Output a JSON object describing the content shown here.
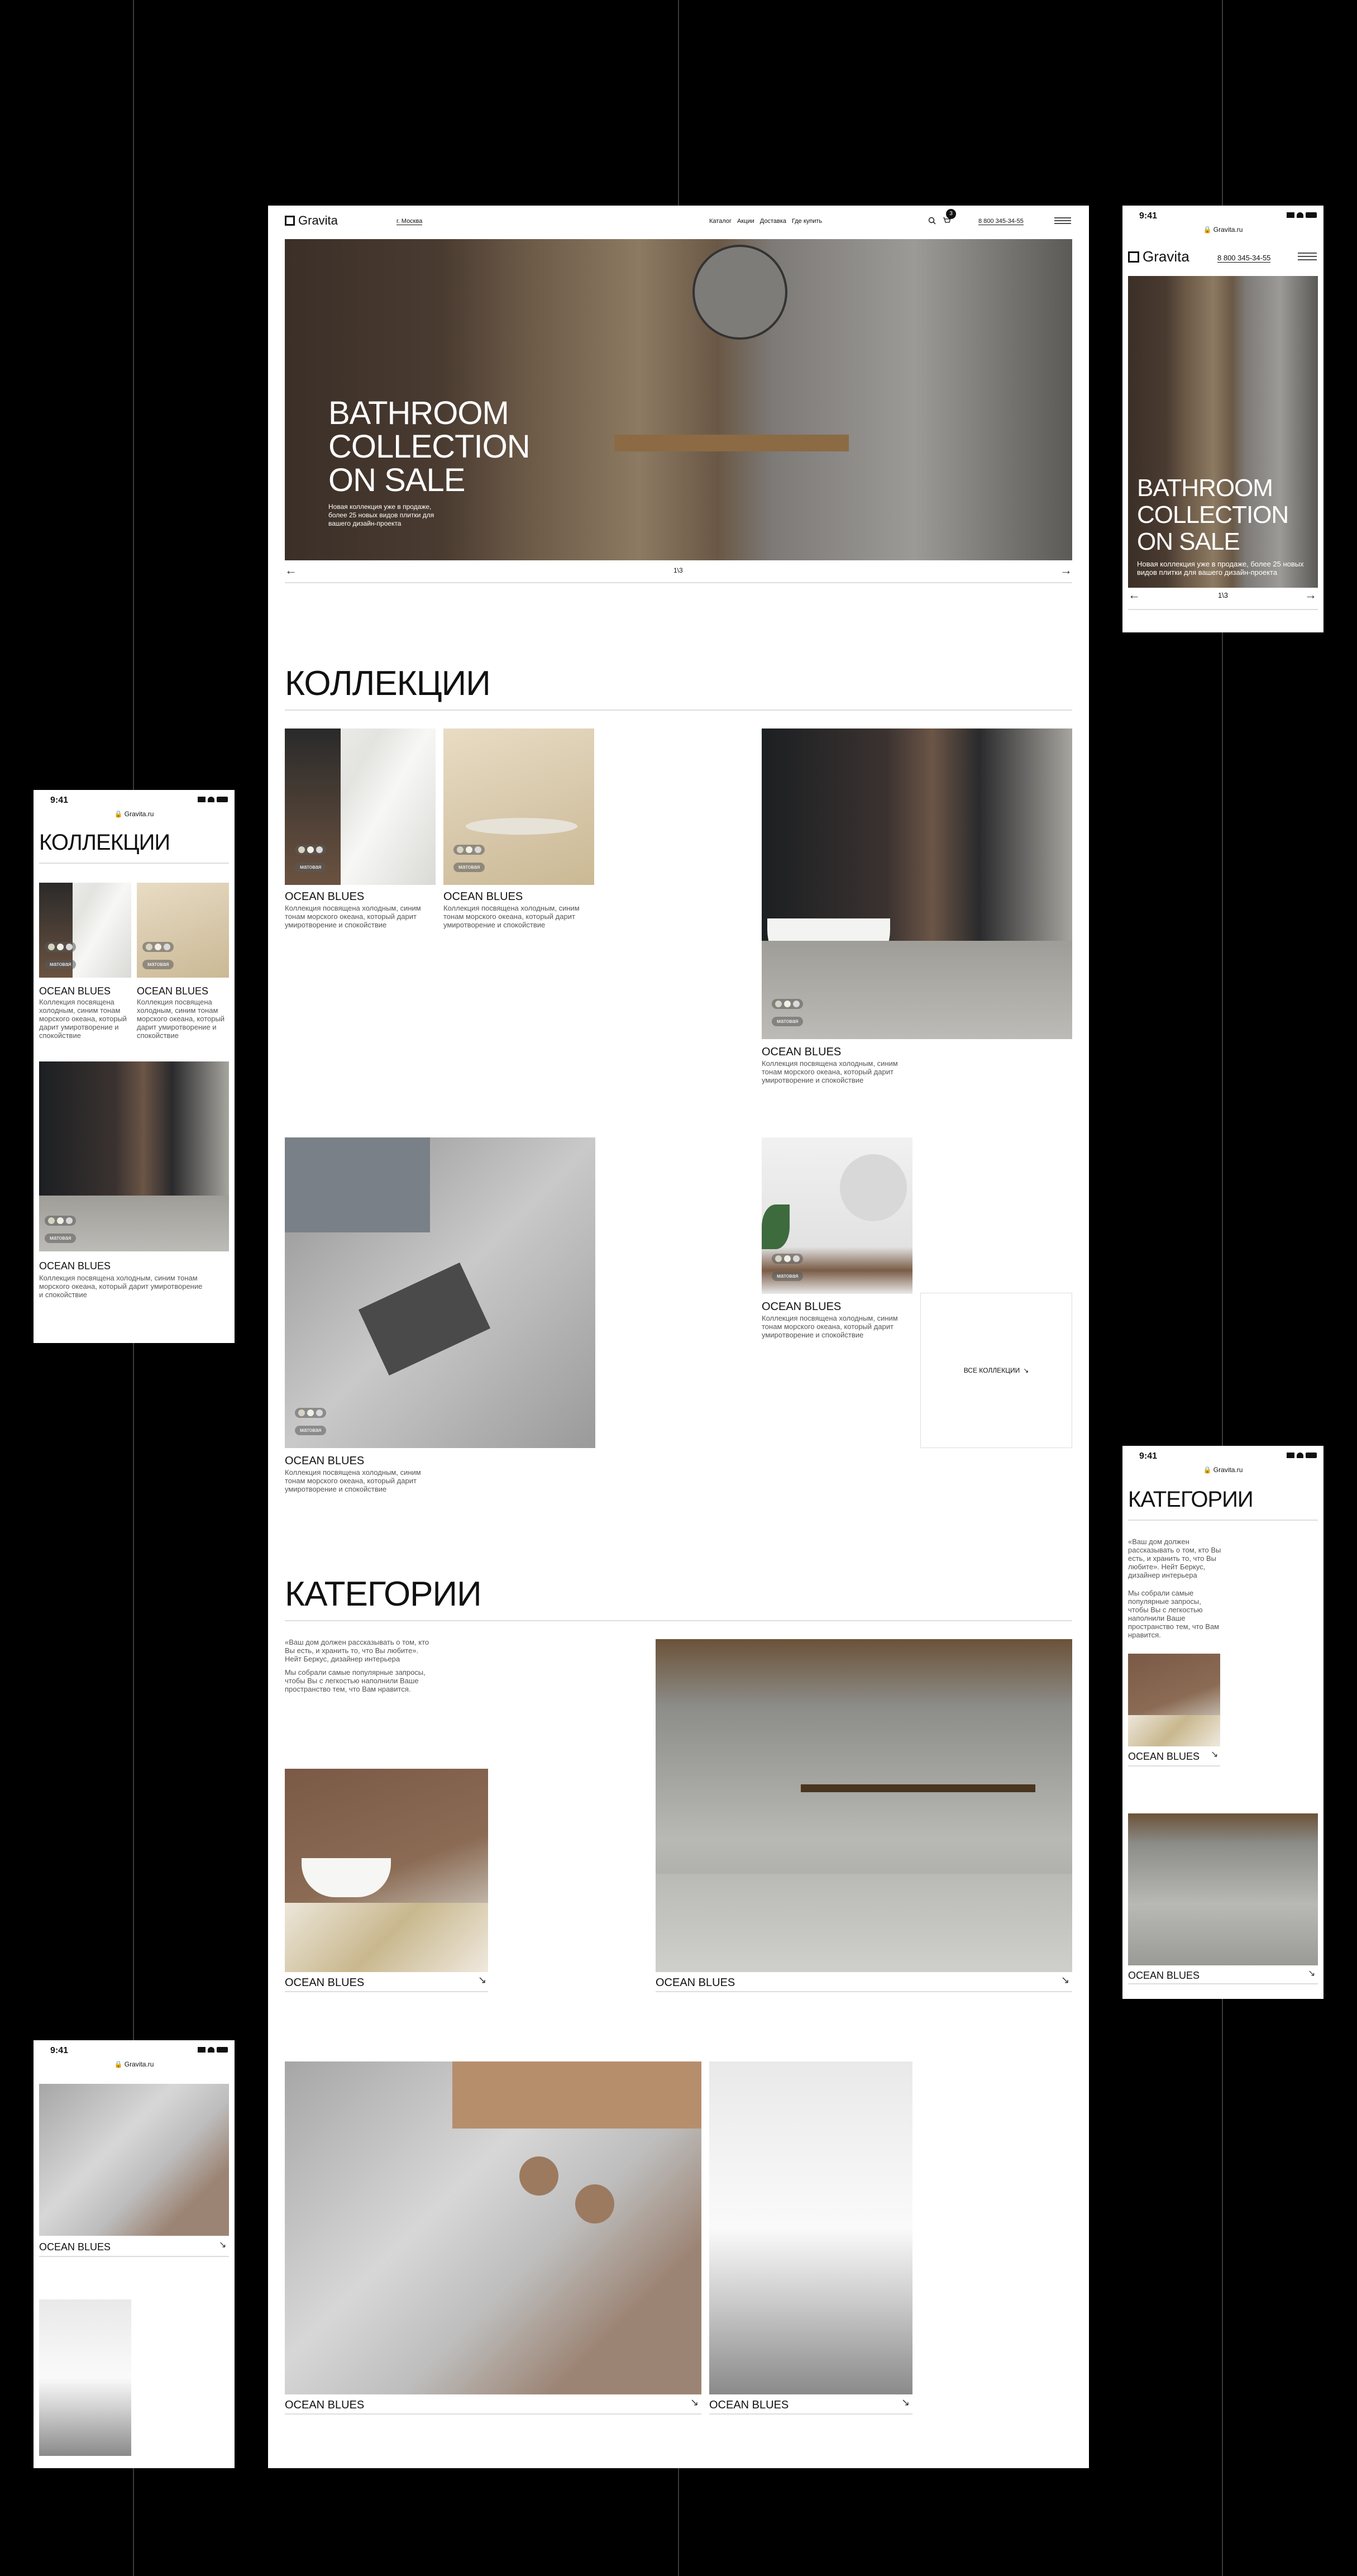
{
  "brand": "Gravita",
  "phone": "8 800 345-34-55",
  "city": "г. Москва",
  "url": "Gravita.ru",
  "status_time": "9:41",
  "cart_count": "3",
  "nav": [
    "Каталог",
    "Акции",
    "Доставка",
    "Где купить"
  ],
  "hero": {
    "title_line1": "BATHROOM",
    "title_line2": "COLLECTION",
    "title_line3": "ON SALE",
    "subtitle": "Новая коллекция уже в продаже, более 25 новых видов плитки для вашего дизайн-проекта",
    "pager": "1\\3"
  },
  "collections": {
    "heading": "КОЛЛЕКЦИИ",
    "item_title": "OCEAN BLUES",
    "item_desc": "Коллекция посвящена холодным, синим тонам морского океана, который дарит умиротворение и спокойствие",
    "finish": "матовая",
    "all_label": "ВСЕ КОЛЛЕКЦИИ",
    "swatches": [
      "#d8d4c4",
      "#f2f0e6",
      "#d9d9d9"
    ]
  },
  "categories": {
    "heading": "КАТЕГОРИИ",
    "intro1": "«Ваш дом должен рассказывать о том, кто Вы есть, и хранить то, что Вы любите». Нейт Беркус, дизайнер интерьера",
    "intro2": "Мы собрали самые популярные запросы, чтобы Вы с легкостью наполнили Ваше пространство тем, что Вам нравится.",
    "item_title": "OCEAN BLUES"
  },
  "icons": [
    "search-icon",
    "cart-icon",
    "menu-icon",
    "arrow-left-icon",
    "arrow-right-icon",
    "arrow-down-right-icon",
    "lock-icon",
    "signal-icon",
    "wifi-icon",
    "battery-icon"
  ]
}
